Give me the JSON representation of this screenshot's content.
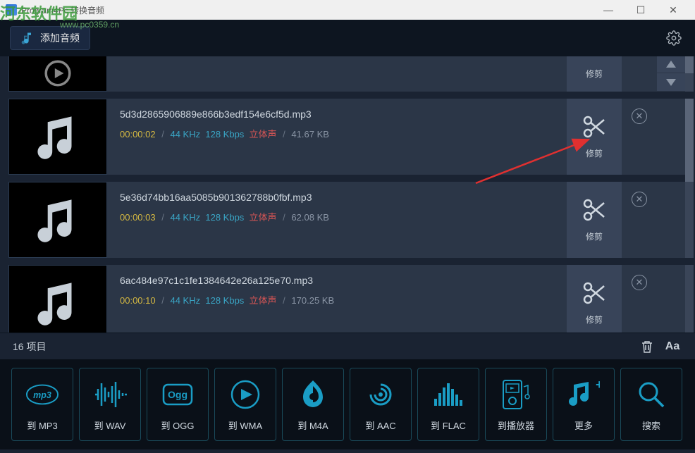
{
  "titlebar": {
    "title": "Program4Pc 转换音频"
  },
  "watermark": {
    "main": "河东软件园",
    "sub": "www.pc0359.cn"
  },
  "toolbar": {
    "add_label": "添加音频"
  },
  "trim": {
    "label": "修剪"
  },
  "files": [
    {
      "name": "5d3d2865906889e866b3edf154e6cf5d.mp3",
      "duration": "00:00:02",
      "freq": "44 KHz",
      "bitrate": "128 Kbps",
      "channels": "立体声",
      "size": "41.67 KB"
    },
    {
      "name": "5e36d74bb16aa5085b901362788b0fbf.mp3",
      "duration": "00:00:03",
      "freq": "44 KHz",
      "bitrate": "128 Kbps",
      "channels": "立体声",
      "size": "62.08 KB"
    },
    {
      "name": "6ac484e97c1c1fe1384642e26a125e70.mp3",
      "duration": "00:00:10",
      "freq": "44 KHz",
      "bitrate": "128 Kbps",
      "channels": "立体声",
      "size": "170.25 KB"
    }
  ],
  "status": {
    "count_label": "16 项目"
  },
  "formats": [
    {
      "label": "到 MP3",
      "icon": "mp3"
    },
    {
      "label": "到 WAV",
      "icon": "wav"
    },
    {
      "label": "到 OGG",
      "icon": "ogg"
    },
    {
      "label": "到 WMA",
      "icon": "wma"
    },
    {
      "label": "到 M4A",
      "icon": "m4a"
    },
    {
      "label": "到 AAC",
      "icon": "aac"
    },
    {
      "label": "到 FLAC",
      "icon": "flac"
    },
    {
      "label": "到播放器",
      "icon": "player"
    },
    {
      "label": "更多",
      "icon": "more"
    },
    {
      "label": "搜索",
      "icon": "search"
    }
  ]
}
